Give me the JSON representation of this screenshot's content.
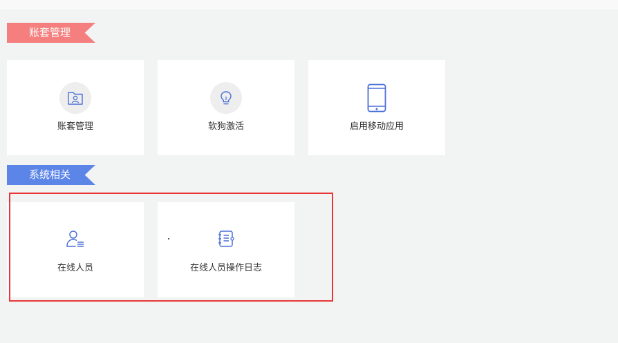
{
  "sections": {
    "account": {
      "title": "账套管理",
      "color": "#f47f7e",
      "cards": [
        {
          "label": "账套管理",
          "icon": "folder-user-icon"
        },
        {
          "label": "软狗激活",
          "icon": "lightbulb-icon"
        },
        {
          "label": "启用移动应用",
          "icon": "mobile-phone-icon"
        }
      ]
    },
    "system": {
      "title": "系统相关",
      "color": "#5c85e8",
      "cards": [
        {
          "label": "在线人员",
          "icon": "online-user-icon"
        },
        {
          "label": "在线人员操作日志",
          "icon": "notebook-log-icon"
        }
      ]
    }
  },
  "colors": {
    "icon_blue": "#4a6fd6",
    "highlight": "#e93535"
  }
}
